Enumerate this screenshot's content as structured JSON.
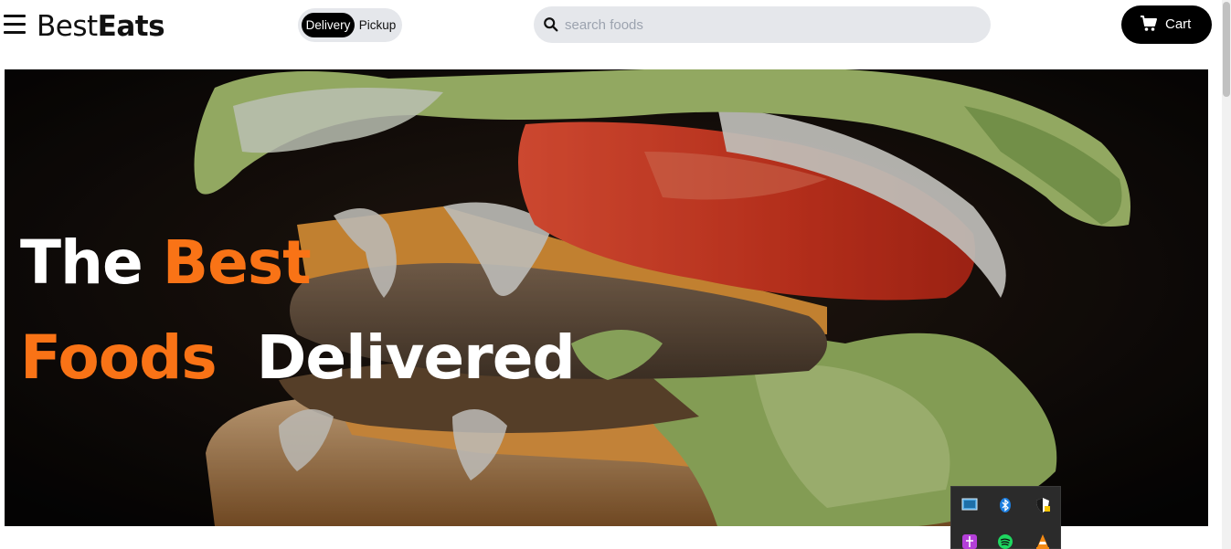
{
  "header": {
    "brand": {
      "part1": "Best",
      "part2": "Eats"
    },
    "toggle": {
      "delivery_label": "Delivery",
      "pickup_label": "Pickup",
      "selected": "Delivery"
    },
    "search": {
      "placeholder": "search foods",
      "value": ""
    },
    "cart_label": "Cart"
  },
  "hero": {
    "line1_word1": "The",
    "line1_word2": "Best",
    "line2_word1": "Foods",
    "line2_word2": "Delivered"
  },
  "tray": {
    "icons": [
      "monitor-icon",
      "bluetooth-icon",
      "security-shield-icon",
      "app-icon",
      "spotify-icon",
      "vlc-icon"
    ]
  },
  "colors": {
    "accent": "#f97316",
    "dark": "#000000",
    "pill_bg": "#e5e7eb"
  }
}
